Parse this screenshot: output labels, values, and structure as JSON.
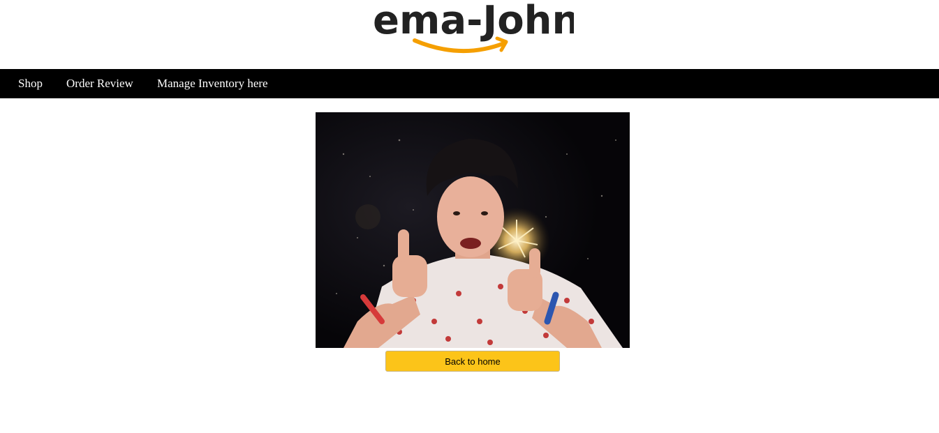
{
  "brand": {
    "logo_text": "ema-John",
    "logo_text_color": "#222222",
    "logo_swoosh_color": "#f59f00"
  },
  "nav": {
    "items": [
      {
        "label": "Shop"
      },
      {
        "label": "Order Review"
      },
      {
        "label": "Manage Inventory here"
      }
    ]
  },
  "main": {
    "image_icon": "celebration-thumbs-up-image",
    "back_button_label": "Back to home",
    "back_button_color": "#fcc419"
  },
  "colors": {
    "navbar_bg": "#000000",
    "nav_text": "#ffffff",
    "page_bg": "#ffffff"
  }
}
